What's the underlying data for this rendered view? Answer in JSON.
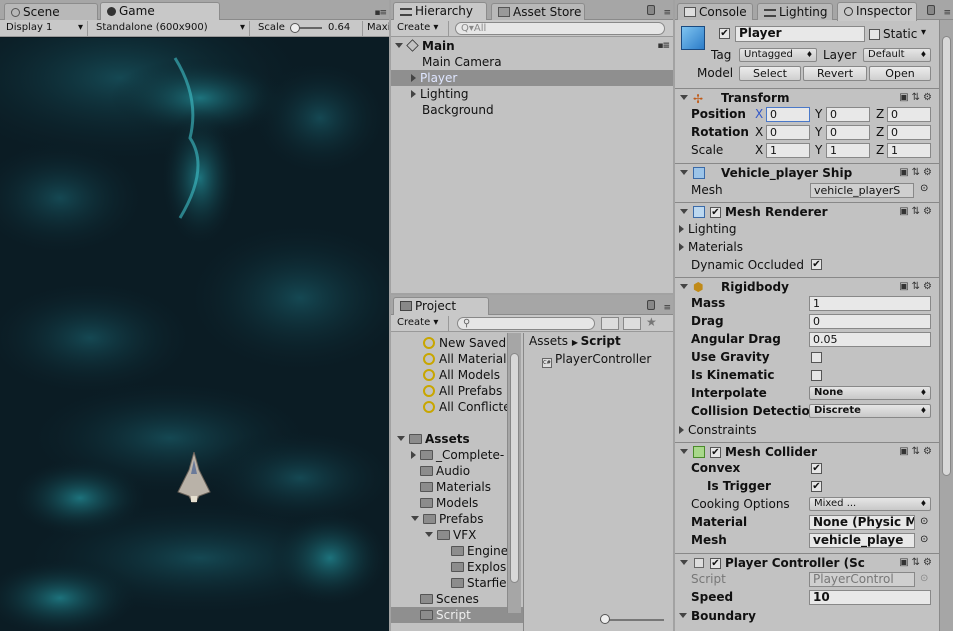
{
  "game_panel": {
    "tabs": [
      {
        "label": "Scene"
      },
      {
        "label": "Game"
      }
    ],
    "toolbar": {
      "display": "Display 1",
      "resolution": "Standalone (600x900)",
      "scale_label": "Scale",
      "scale_value": "0.64",
      "maximize": "Maxi"
    }
  },
  "hierarchy": {
    "tabs": [
      {
        "label": "Hierarchy"
      },
      {
        "label": "Asset Store"
      }
    ],
    "create": "Create",
    "search_placeholder": "Q▾All",
    "scene": "Main",
    "items": [
      {
        "label": "Main Camera"
      },
      {
        "label": "Player"
      },
      {
        "label": "Lighting"
      },
      {
        "label": "Background"
      }
    ]
  },
  "project": {
    "tab": "Project",
    "create": "Create",
    "favorites": [
      {
        "label": "New Saved"
      },
      {
        "label": "All Materials"
      },
      {
        "label": "All Models"
      },
      {
        "label": "All Prefabs"
      },
      {
        "label": "All Conflicte"
      }
    ],
    "assets_label": "Assets",
    "tree": [
      {
        "label": "_Complete-"
      },
      {
        "label": "Audio"
      },
      {
        "label": "Materials"
      },
      {
        "label": "Models"
      },
      {
        "label": "Prefabs"
      },
      {
        "label": "VFX"
      },
      {
        "label": "Engines"
      },
      {
        "label": "Explosio"
      },
      {
        "label": "Starfiel"
      },
      {
        "label": "Scenes"
      },
      {
        "label": "Script"
      }
    ],
    "breadcrumb": {
      "root": "Assets",
      "current": "Script"
    },
    "files": [
      {
        "label": "PlayerController"
      }
    ]
  },
  "inspector": {
    "tabs": [
      {
        "label": "Console"
      },
      {
        "label": "Lighting"
      },
      {
        "label": "Inspector"
      }
    ],
    "object_name": "Player",
    "static_label": "Static",
    "tag_label": "Tag",
    "tag_value": "Untagged",
    "layer_label": "Layer",
    "layer_value": "Default",
    "model_label": "Model",
    "model_buttons": {
      "select": "Select",
      "revert": "Revert",
      "open": "Open"
    },
    "transform": {
      "title": "Transform",
      "position_label": "Position",
      "rotation_label": "Rotation",
      "scale_label": "Scale",
      "position": {
        "x": "0",
        "y": "0",
        "z": "0"
      },
      "rotation": {
        "x": "0",
        "y": "0",
        "z": "0"
      },
      "scale": {
        "x": "1",
        "y": "1",
        "z": "1"
      }
    },
    "mesh_filter": {
      "title": "Vehicle_player Ship (",
      "mesh_label": "Mesh",
      "mesh_value": "vehicle_playerS"
    },
    "mesh_renderer": {
      "title": "Mesh Renderer",
      "lighting": "Lighting",
      "materials": "Materials",
      "dynamic_occluded": "Dynamic Occluded"
    },
    "rigidbody": {
      "title": "Rigidbody",
      "mass_label": "Mass",
      "mass": "1",
      "drag_label": "Drag",
      "drag": "0",
      "angular_drag_label": "Angular Drag",
      "angular_drag": "0.05",
      "use_gravity": "Use Gravity",
      "is_kinematic": "Is Kinematic",
      "interpolate_label": "Interpolate",
      "interpolate": "None",
      "collision_label": "Collision Detection",
      "collision": "Discrete",
      "constraints": "Constraints"
    },
    "mesh_collider": {
      "title": "Mesh Collider",
      "convex": "Convex",
      "is_trigger": "Is Trigger",
      "cooking_label": "Cooking Options",
      "cooking": "Mixed ...",
      "material_label": "Material",
      "material": "None (Physic M",
      "mesh_label": "Mesh",
      "mesh": "vehicle_playe"
    },
    "player_controller": {
      "title": "Player Controller (Sc",
      "script_label": "Script",
      "script": "PlayerControl",
      "speed_label": "Speed",
      "speed": "10",
      "boundary_label": "Boundary"
    }
  }
}
